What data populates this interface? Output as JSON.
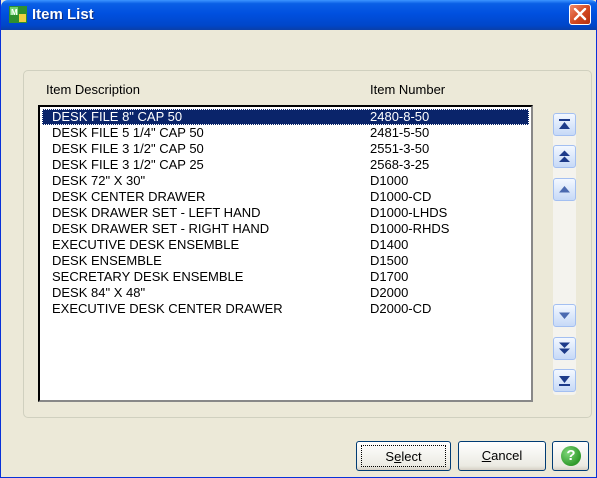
{
  "window": {
    "title": "Item List"
  },
  "columns": {
    "description": "Item Description",
    "number": "Item Number"
  },
  "items": [
    {
      "description": "DESK FILE 8\" CAP 50",
      "number": "2480-8-50"
    },
    {
      "description": "DESK FILE 5 1/4\" CAP 50",
      "number": "2481-5-50"
    },
    {
      "description": "DESK FILE 3 1/2\" CAP 50",
      "number": "2551-3-50"
    },
    {
      "description": "DESK FILE 3 1/2\" CAP 25",
      "number": "2568-3-25"
    },
    {
      "description": "DESK 72\" X 30\"",
      "number": "D1000"
    },
    {
      "description": "DESK CENTER DRAWER",
      "number": "D1000-CD"
    },
    {
      "description": "DESK DRAWER SET - LEFT HAND",
      "number": "D1000-LHDS"
    },
    {
      "description": "DESK DRAWER SET - RIGHT HAND",
      "number": "D1000-RHDS"
    },
    {
      "description": "EXECUTIVE DESK ENSEMBLE",
      "number": "D1400"
    },
    {
      "description": "DESK ENSEMBLE",
      "number": "D1500"
    },
    {
      "description": "SECRETARY DESK ENSEMBLE",
      "number": "D1700"
    },
    {
      "description": "DESK 84\" X 48\"",
      "number": "D2000"
    },
    {
      "description": "EXECUTIVE DESK CENTER DRAWER",
      "number": "D2000-CD"
    }
  ],
  "buttons": {
    "select": "Select",
    "select_mnemonic": "e",
    "cancel": "Cancel",
    "cancel_mnemonic": "C"
  },
  "icons": {
    "app": "app-icon",
    "close": "close-icon",
    "first": "scroll-first-icon",
    "page_up": "scroll-page-up-icon",
    "up": "scroll-up-icon",
    "down": "scroll-down-icon",
    "page_down": "scroll-page-down-icon",
    "last": "scroll-last-icon",
    "help": "help-icon"
  },
  "colors": {
    "title_bar": "#0050df",
    "selection": "#0a246a",
    "close": "#d2471f",
    "help": "#2f9a2b"
  }
}
